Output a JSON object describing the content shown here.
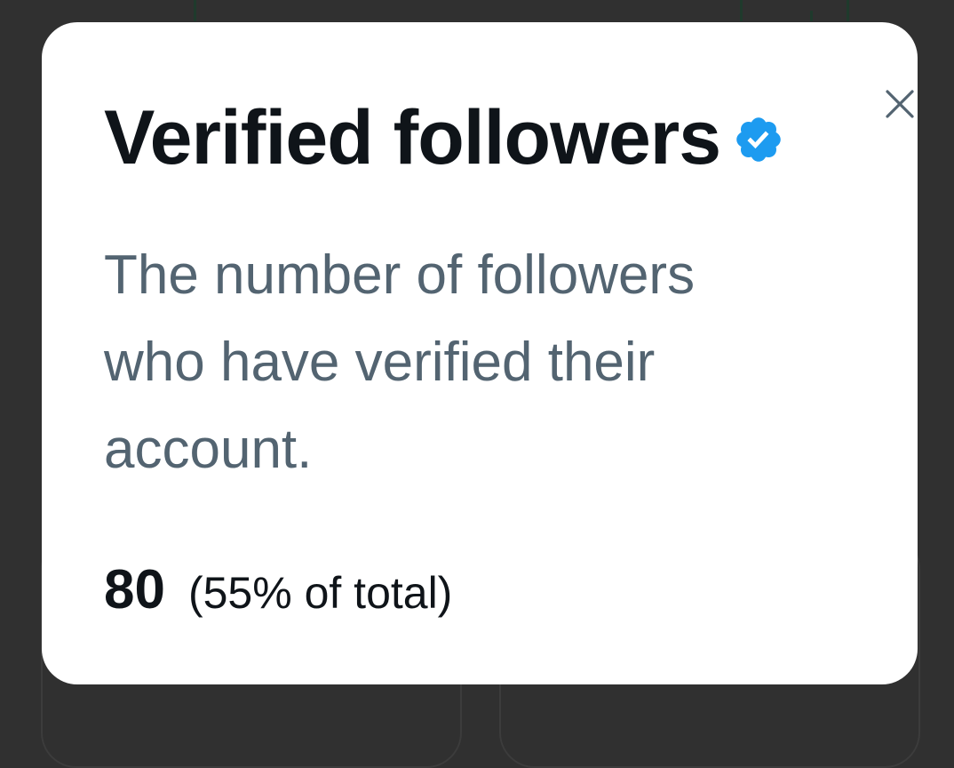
{
  "modal": {
    "title": "Verified followers",
    "title_icon": "verified-badge-icon",
    "description": "The number of followers who have verified their account.",
    "stat_value": "80",
    "stat_detail": "(55% of total)",
    "close_icon": "close-icon"
  },
  "colors": {
    "accent": "#1d9bf0",
    "title_text": "#0f1419",
    "secondary_text": "#536471",
    "backdrop": "#303030"
  }
}
